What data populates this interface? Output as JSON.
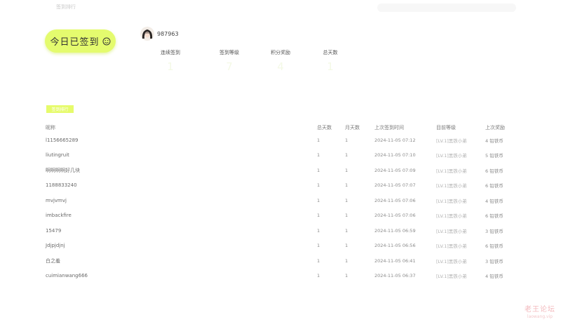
{
  "nav": {
    "title": "签到排行"
  },
  "checkin": {
    "label": "今日已签到",
    "icon": "smile-icon"
  },
  "user": {
    "name": "987963",
    "avatar_icon": "avatar-icon"
  },
  "stats": [
    {
      "label": "连续签到",
      "value": "1"
    },
    {
      "label": "签到等级",
      "value": "7"
    },
    {
      "label": "积分奖励",
      "value": "4"
    },
    {
      "label": "总天数",
      "value": "1"
    }
  ],
  "section": {
    "tag": "签到排行"
  },
  "table": {
    "headers": [
      "昵称",
      "总天数",
      "月天数",
      "上次签到时间",
      "目前等级",
      "上次奖励"
    ],
    "rows": [
      [
        "l1156665289",
        "1",
        "1",
        "2024-11-05 07:12",
        "[LV.1]黑铁小弟",
        "4 铅铁币"
      ],
      [
        "liutingruit",
        "1",
        "1",
        "2024-11-05 07:10",
        "[LV.1]黑铁小弟",
        "5 铅铁币"
      ],
      [
        "啊啊啊啊好几块",
        "1",
        "1",
        "2024-11-05 07:09",
        "[LV.1]黑铁小弟",
        "6 铅铁币"
      ],
      [
        "1188833240",
        "1",
        "1",
        "2024-11-05 07:07",
        "[LV.1]黑铁小弟",
        "6 铅铁币"
      ],
      [
        "mvjvmvj",
        "1",
        "1",
        "2024-11-05 07:06",
        "[LV.1]黑铁小弟",
        "4 铅铁币"
      ],
      [
        "imbackfire",
        "1",
        "1",
        "2024-11-05 07:06",
        "[LV.1]黑铁小弟",
        "6 铅铁币"
      ],
      [
        "15479",
        "1",
        "1",
        "2024-11-05 06:59",
        "[LV.1]黑铁小弟",
        "3 铅铁币"
      ],
      [
        "Jdjpjdjnj",
        "1",
        "1",
        "2024-11-05 06:56",
        "[LV.1]黑铁小弟",
        "6 铅铁币"
      ],
      [
        "白之羞",
        "1",
        "1",
        "2024-11-05 06:41",
        "[LV.1]黑铁小弟",
        "3 铅铁币"
      ],
      [
        "cuimianwang666",
        "1",
        "1",
        "2024-11-05 06:37",
        "[LV.1]黑铁小弟",
        "4 铅铁币"
      ]
    ]
  },
  "watermark": {
    "title": "老王论坛",
    "url": "laowang.vip"
  }
}
